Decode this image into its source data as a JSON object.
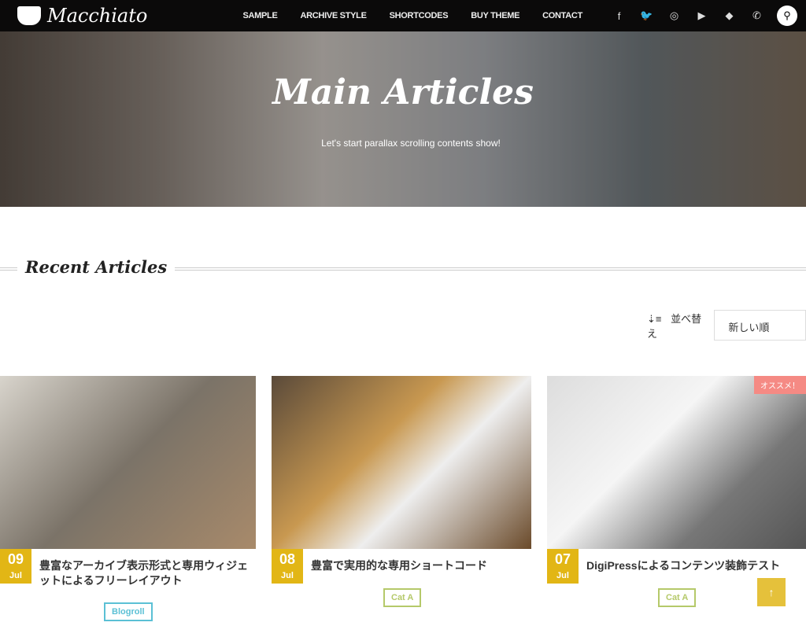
{
  "nav": {
    "logo": "Macchiato",
    "items": [
      "SAMPLE",
      "ARCHIVE STYLE",
      "SHORTCODES",
      "BUY THEME",
      "CONTACT"
    ],
    "social": [
      {
        "icon": "facebook-icon",
        "glyph": "f"
      },
      {
        "icon": "twitter-icon",
        "glyph": "🐦"
      },
      {
        "icon": "instagram-icon",
        "glyph": "◎"
      },
      {
        "icon": "youtube-icon",
        "glyph": "▶"
      },
      {
        "icon": "feedly-icon",
        "glyph": "◆"
      },
      {
        "icon": "phone-icon",
        "glyph": "✆"
      }
    ],
    "search_icon": "search-icon"
  },
  "hero": {
    "title": "Main Articles",
    "subtitle": "Let's start parallax scrolling contents show!"
  },
  "section": {
    "title": "Recent Articles"
  },
  "sort": {
    "label": "並べ替え",
    "selected": "新しい順"
  },
  "articles": [
    {
      "day": "09",
      "month": "Jul",
      "title": "豊富なアーカイブ表示形式と専用ウィジェットによるフリーレイアウト",
      "category": "Blogroll",
      "cat_color": "#5bc0d5"
    },
    {
      "day": "08",
      "month": "Jul",
      "title": "豊富で実用的な専用ショートコード",
      "category": "Cat A",
      "cat_color": "#b5c96a"
    },
    {
      "day": "07",
      "month": "Jul",
      "title": "DigiPressによるコンテンツ装飾テスト",
      "category": "Cat A",
      "cat_color": "#b5c96a",
      "badge": "オススメ！"
    }
  ],
  "accent": "#e2b615",
  "back_to_top": "↑"
}
